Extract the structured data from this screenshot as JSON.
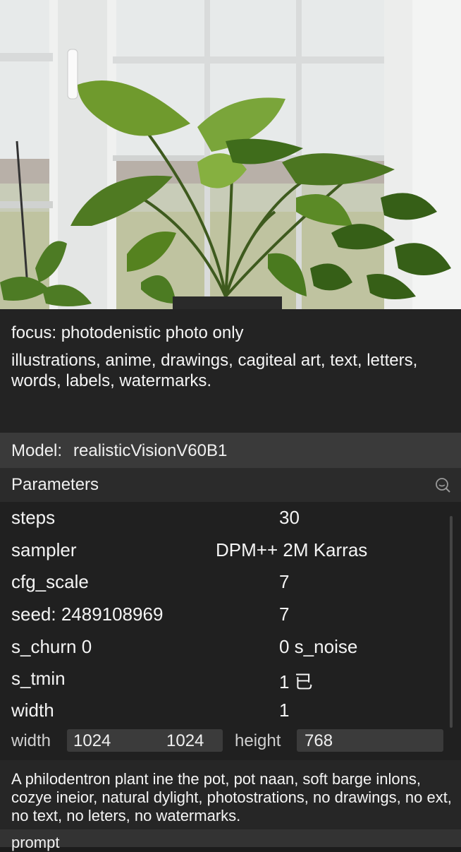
{
  "photo": {
    "subject": "philodendron plant in pot by window"
  },
  "negative": {
    "line1": "focus: photodenistic photo only",
    "line2": "illustrations, anime, drawings, cagiteal art, text, letters, words, labels, watermarks."
  },
  "model": {
    "label": "Model:",
    "value": "realisticVisionV60B1"
  },
  "parameters": {
    "title": "Parameters",
    "rows": [
      {
        "key": "steps",
        "value": "30"
      },
      {
        "key": "sampler",
        "value": "DPM++ 2M Karras"
      },
      {
        "key": "cfg_scale",
        "value": "7"
      },
      {
        "key": "seed: 2489108969",
        "value": "7"
      },
      {
        "key": "s_churn 0",
        "value": "0 s_noise"
      },
      {
        "key": "s_tmin",
        "value": "1 已"
      },
      {
        "key": "width",
        "value": "1"
      }
    ],
    "dims": {
      "width_label": "width",
      "width_value": "1024",
      "width_value2": "1024",
      "height_label": "height",
      "height_value": "768"
    }
  },
  "prompt": {
    "text": "A philodentron plant ine the pot, pot naan, soft barge inlons, cozye ineior, natural dylight, photostrations, no drawings, no ext, no text, no leters, no watermarks.",
    "label": "prompt"
  },
  "colors": {
    "panel": "#232323",
    "header": "#3a3a3a",
    "input": "#3b3b3b"
  },
  "icons": {
    "params": "search-icon"
  }
}
